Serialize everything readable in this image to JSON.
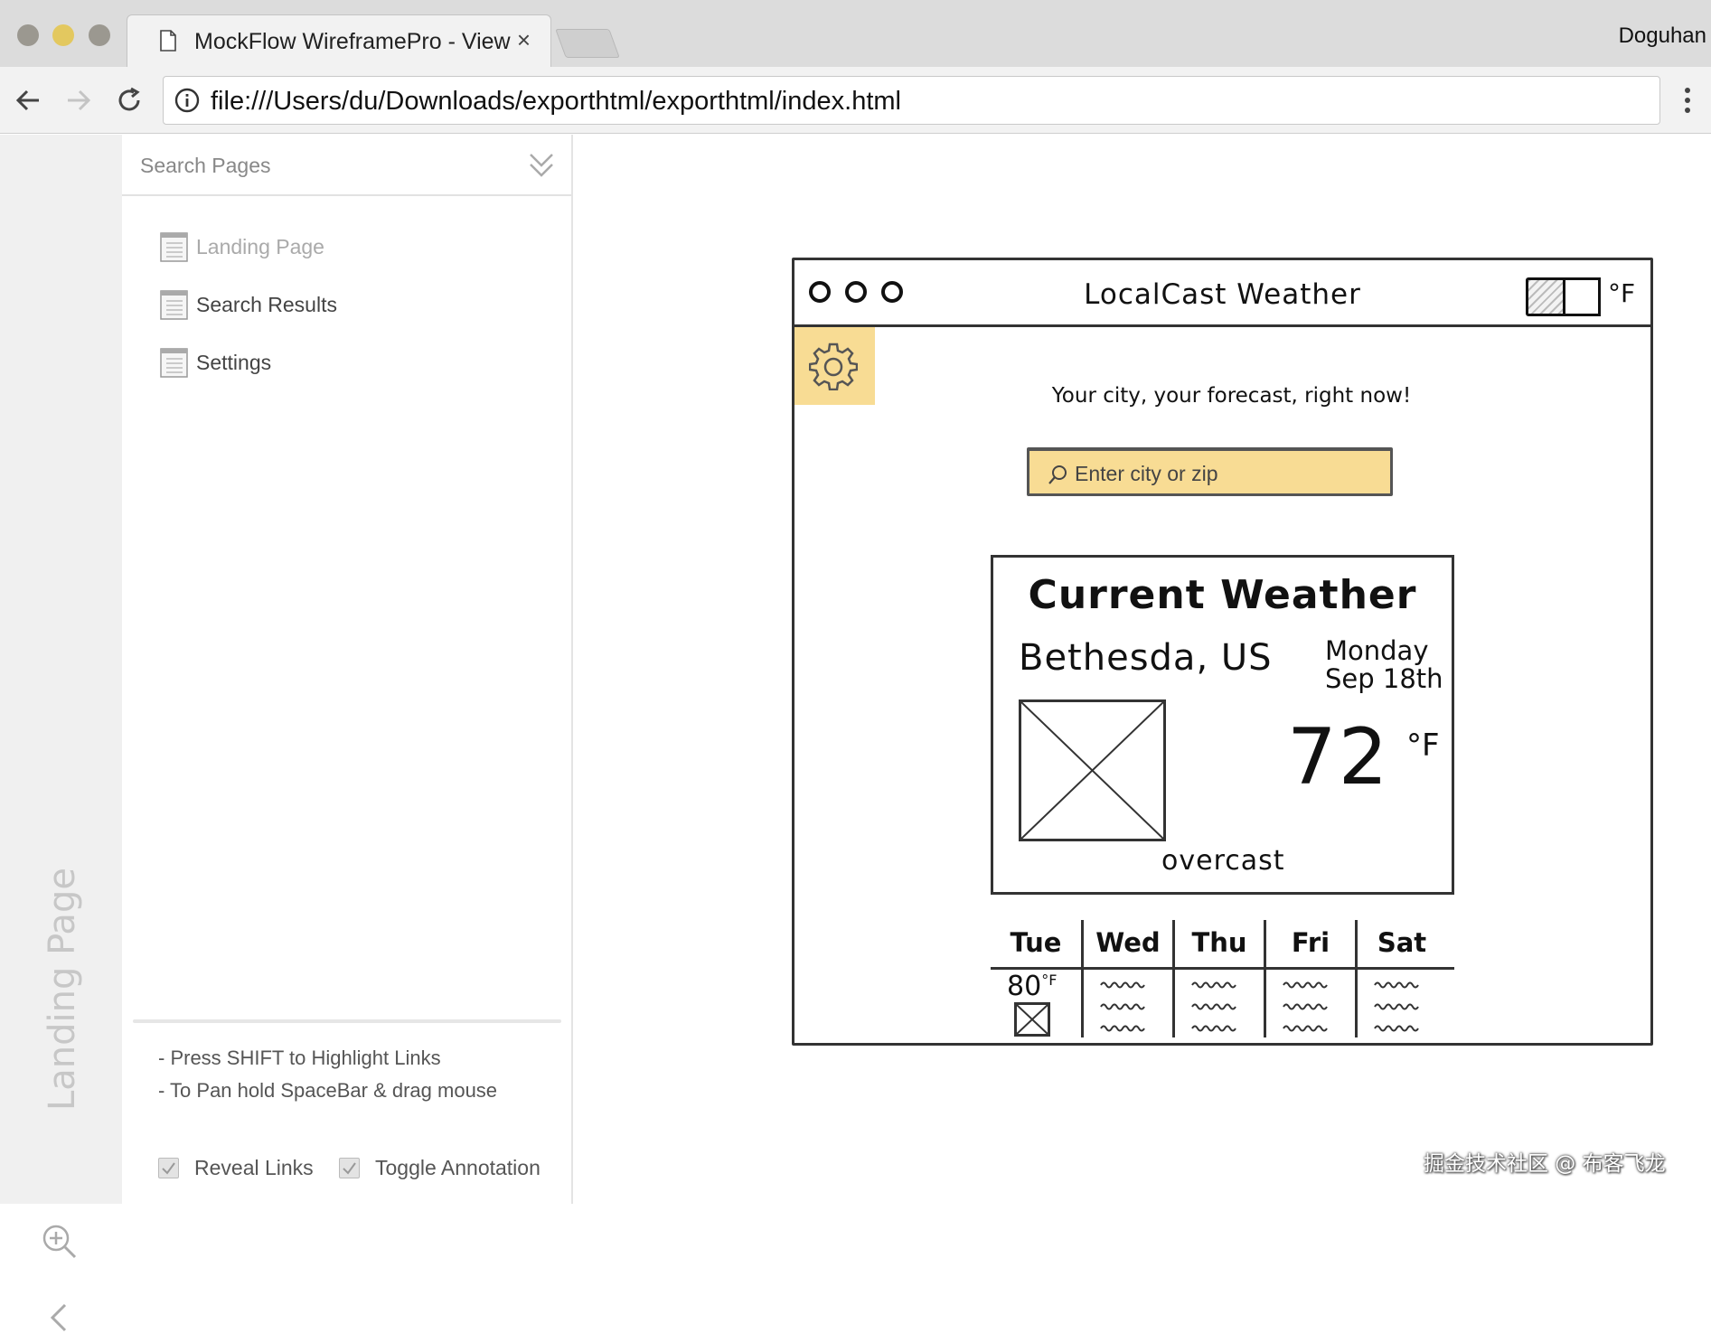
{
  "browser": {
    "tab_title": "MockFlow WireframePro - View",
    "tab_close": "×",
    "profile_name": "Doguhan",
    "url": "file:///Users/du/Downloads/exporthtml/exporthtml/index.html"
  },
  "rail": {
    "vertical_label": "Landing Page"
  },
  "pages_panel": {
    "search_placeholder": "Search Pages",
    "pages": [
      {
        "label": "Landing Page",
        "active": true
      },
      {
        "label": "Search Results",
        "active": false
      },
      {
        "label": "Settings",
        "active": false
      }
    ],
    "hints": [
      "- Press SHIFT to Highlight Links",
      "- To Pan hold SpaceBar & drag mouse"
    ],
    "reveal_links_label": "Reveal Links",
    "toggle_annotation_label": "Toggle Annotation"
  },
  "wireframe": {
    "app_title": "LocalCast Weather",
    "unit_toggle_label": "°F",
    "tagline": "Your city, your forecast, right now!",
    "search_placeholder": "Enter city or zip",
    "card_title": "Current Weather",
    "city": "Bethesda, US",
    "day": "Monday",
    "date": "Sep 18th",
    "temperature": "72",
    "temperature_unit": "°F",
    "condition": "overcast",
    "forecast": [
      {
        "day": "Tue",
        "temp": "80",
        "unit": "°F"
      },
      {
        "day": "Wed"
      },
      {
        "day": "Thu"
      },
      {
        "day": "Fri"
      },
      {
        "day": "Sat"
      }
    ]
  },
  "watermark": "掘金技术社区 @ 布客飞龙",
  "colors": {
    "sketch_yellow": "#f8dc94",
    "chrome_bg": "#dcdcdc",
    "rail_bg": "#f0f0f0"
  }
}
